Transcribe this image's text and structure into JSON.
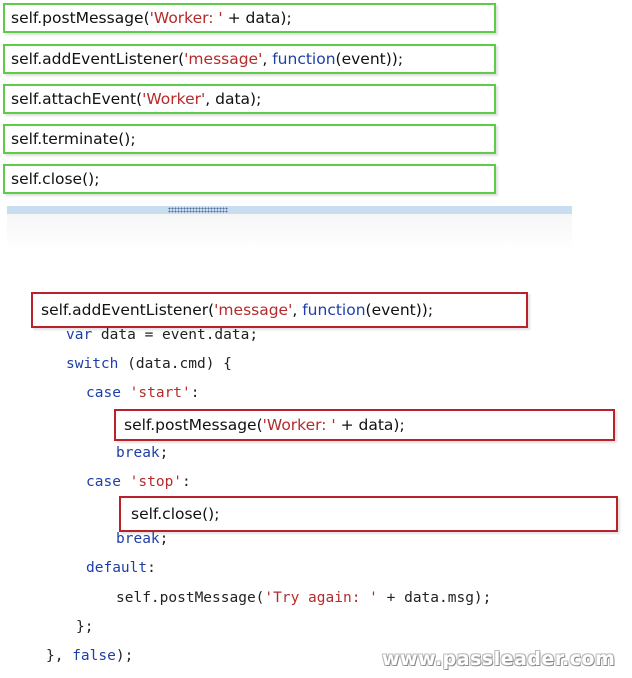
{
  "options": [
    {
      "pre": "self.postMessage(",
      "str": "'Worker: '",
      "post": " + data);"
    },
    {
      "pre": "self.addEventListener(",
      "str": "'message'",
      "mid": ", ",
      "kw": "function",
      "post": "(event));"
    },
    {
      "pre": "self.attachEvent(",
      "str": "'Worker'",
      "post": ", data);"
    },
    {
      "pre": "self.terminate();"
    },
    {
      "pre": "self.close();"
    }
  ],
  "slots": {
    "listener": {
      "pre": "self.addEventListener(",
      "str": "'message'",
      "mid": ", ",
      "kw": "function",
      "post": "(event));"
    },
    "start": {
      "pre": "self.postMessage(",
      "str": "'Worker: '",
      "post": " + data);"
    },
    "stop": {
      "pre": "self.close();"
    }
  },
  "code": {
    "l1_kw": "var",
    "l1_rest": " data = event.data;",
    "l2_kw": "switch",
    "l2_rest": " (data.cmd) {",
    "l3_kw": "case",
    "l3_str": "'start'",
    "l3_rest": ":",
    "l4_kw": "break",
    "l4_rest": ";",
    "l5_kw": "case",
    "l5_str": "'stop'",
    "l5_rest": ":",
    "l6_kw": "break",
    "l6_rest": ";",
    "l7_kw": "default",
    "l7_rest": ":",
    "l8_pre": "self.postMessage(",
    "l8_str": "'Try again: '",
    "l8_rest": " + data.msg);",
    "l9": "};",
    "l10_pre": "}, ",
    "l10_kw": "false",
    "l10_rest": ");"
  },
  "watermark": "www.passleader.com"
}
